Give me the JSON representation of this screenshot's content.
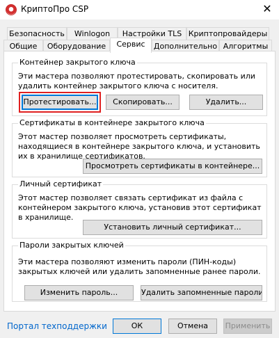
{
  "window": {
    "title": "КриптоПро CSP",
    "close_glyph": "✕"
  },
  "tabs_row1": [
    "Безопасность",
    "Winlogon",
    "Настройки TLS",
    "Криптопровайдеры"
  ],
  "tabs_row2": [
    "Общие",
    "Оборудование",
    "Сервис",
    "Дополнительно",
    "Алгоритмы"
  ],
  "active_tab": "Сервис",
  "groups": {
    "container": {
      "title": "Контейнер закрытого ключа",
      "desc": "Эти мастера позволяют протестировать, скопировать или удалить контейнер закрытого ключа с носителя.",
      "btn_test": "Протестировать...",
      "btn_copy": "Скопировать...",
      "btn_delete": "Удалить..."
    },
    "certs": {
      "title": "Сертификаты в контейнере закрытого ключа",
      "desc": "Этот мастер позволяет просмотреть сертификаты, находящиеся в контейнере закрытого ключа, и установить их в хранилище сертификатов.",
      "btn_view": "Просмотреть сертификаты в контейнере..."
    },
    "personal": {
      "title": "Личный сертификат",
      "desc": "Этот мастер позволяет связать сертификат из файла с контейнером закрытого ключа, установив этот сертификат в хранилище.",
      "btn_install": "Установить личный сертификат..."
    },
    "passwords": {
      "title": "Пароли закрытых ключей",
      "desc": "Эти мастера позволяют изменить пароли (ПИН-коды) закрытых ключей или удалить запомненные ранее пароли.",
      "btn_change": "Изменить пароль...",
      "btn_remove": "Удалить запомненные пароли..."
    }
  },
  "footer": {
    "support_link": "Портал техподдержки",
    "ok": "ОК",
    "cancel": "Отмена",
    "apply": "Применить"
  }
}
